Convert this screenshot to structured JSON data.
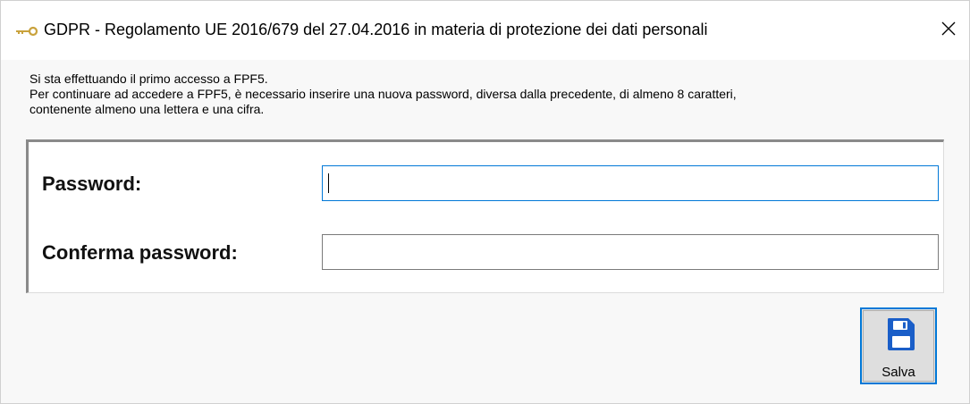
{
  "window": {
    "title": "GDPR - Regolamento UE 2016/679 del 27.04.2016 in materia di protezione dei dati personali",
    "title_icon": "key-icon",
    "close_glyph": "✕"
  },
  "message": {
    "lines": [
      "Si sta effettuando il primo accesso a FPF5.",
      "Per continuare ad accedere a FPF5, è necessario inserire una nuova password, diversa dalla precedente, di almeno 8 caratteri,",
      "contenente almeno una lettera e una cifra."
    ]
  },
  "form": {
    "password": {
      "label": "Password:",
      "value": "",
      "placeholder": ""
    },
    "confirm": {
      "label": "Conferma password:",
      "value": "",
      "placeholder": ""
    }
  },
  "actions": {
    "save": {
      "label": "Salva",
      "icon": "floppy-disk-icon"
    }
  },
  "colors": {
    "accent": "#0078d7",
    "floppy": "#1a5ec8",
    "key": "#c9a23c"
  }
}
